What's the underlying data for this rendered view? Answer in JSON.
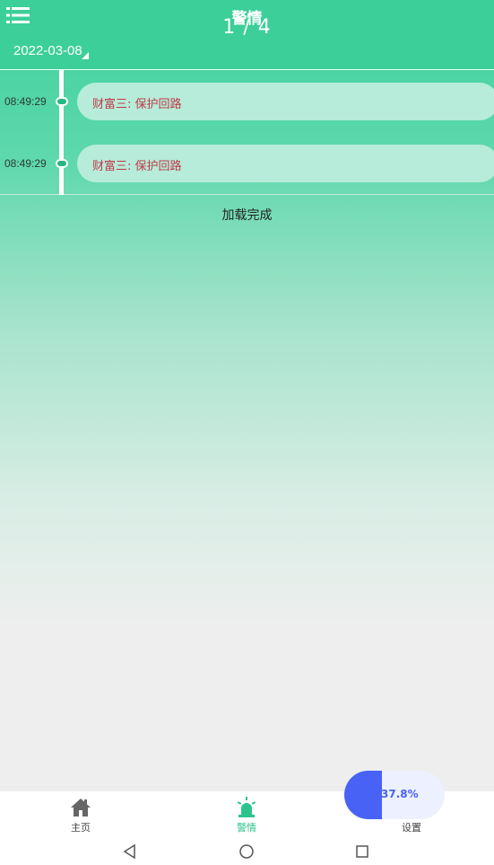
{
  "header": {
    "title": "警情",
    "pager": "1 / 4",
    "date": "2022-03-08",
    "menu_icon": "menu-list-icon",
    "background": "#3ccf9a"
  },
  "alerts": [
    {
      "time": "08:49:29",
      "text": "财富三: 保护回路"
    },
    {
      "time": "08:49:29",
      "text": "财富三: 保护回路"
    }
  ],
  "load_status": "加载完成",
  "bottom_nav": {
    "items": [
      {
        "label": "主页",
        "icon": "home-icon"
      },
      {
        "label": "警情",
        "icon": "alarm-icon",
        "active": true
      },
      {
        "label": "设置",
        "icon": "settings-icon"
      }
    ],
    "active_color": "#2cc38d"
  },
  "progress": {
    "text": "37.8%",
    "value": 0.378,
    "color": "#4862f5"
  },
  "system_nav": [
    "back-icon",
    "home-circle-icon",
    "recents-icon"
  ]
}
